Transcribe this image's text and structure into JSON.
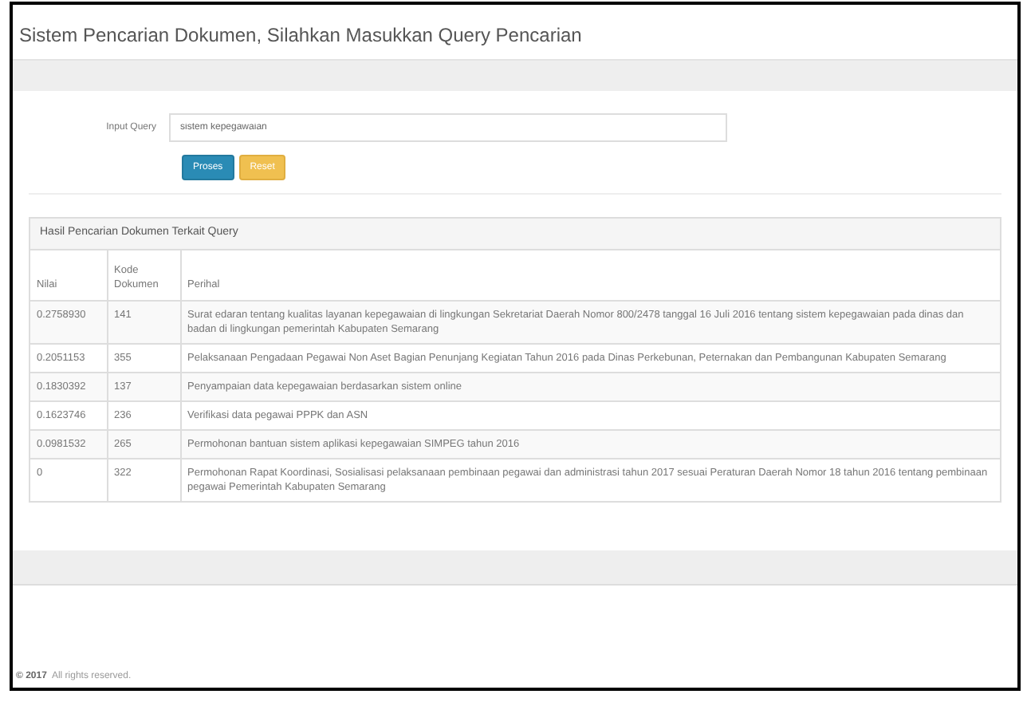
{
  "page_title": "Sistem Pencarian Dokumen, Silahkan Masukkan Query Pencarian",
  "form": {
    "label": "Input Query",
    "value": "sistem kepegawaian",
    "buttons": [
      {
        "label": "Proses",
        "kind": "primary"
      },
      {
        "label": "Reset",
        "kind": "warning"
      }
    ]
  },
  "results": {
    "title": "Hasil Pencarian Dokumen Terkait Query",
    "columns": [
      "Nilai",
      "Kode Dokumen",
      "Perihal"
    ],
    "rows": [
      {
        "cells": [
          "0.2758930",
          "141",
          "Surat edaran tentang kualitas layanan kepegawaian di lingkungan Sekretariat Daerah Nomor 800/2478 tanggal 16 Juli 2016 tentang sistem kepegawaian pada dinas dan badan di lingkungan pemerintah Kabupaten Semarang"
        ]
      },
      {
        "cells": [
          "0.2051153",
          "355",
          "Pelaksanaan Pengadaan Pegawai Non Aset Bagian Penunjang Kegiatan Tahun 2016 pada Dinas Perkebunan, Peternakan dan Pembangunan Kabupaten Semarang"
        ]
      },
      {
        "cells": [
          "0.1830392",
          "137",
          "Penyampaian data kepegawaian berdasarkan sistem online"
        ]
      },
      {
        "cells": [
          "0.1623746",
          "236",
          "Verifikasi data pegawai PPPK dan ASN"
        ]
      },
      {
        "cells": [
          "0.0981532",
          "265",
          "Permohonan bantuan sistem aplikasi kepegawaian SIMPEG tahun 2016"
        ]
      },
      {
        "cells": [
          "0",
          "322",
          "Permohonan Rapat Koordinasi, Sosialisasi pelaksanaan pembinaan pegawai dan administrasi tahun 2017 sesuai Peraturan Daerah Nomor 18 tahun 2016 tentang pembinaan pegawai Pemerintah Kabupaten Semarang"
        ]
      }
    ]
  },
  "footer": {
    "brand": "© 2017",
    "text": "All rights reserved."
  }
}
